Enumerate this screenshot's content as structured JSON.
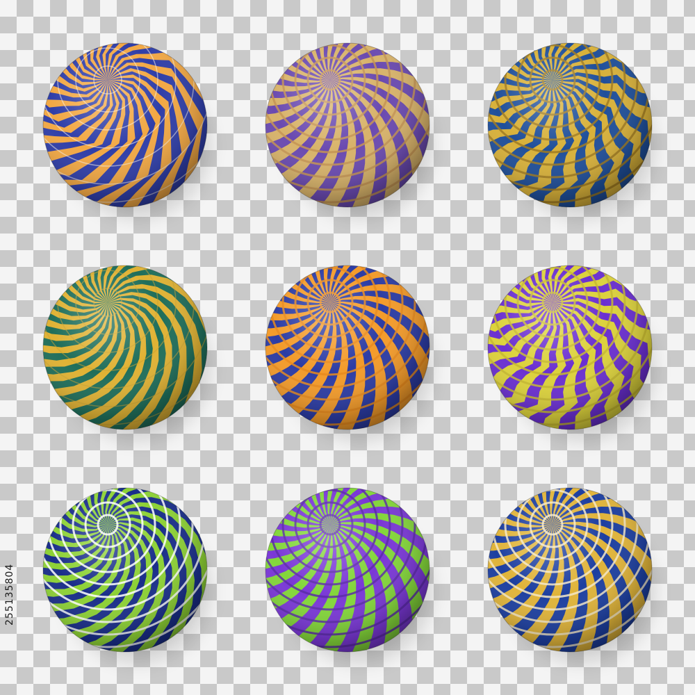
{
  "scene": {
    "background": {
      "light": "#f4f4f4",
      "dark": "#c9c9c9"
    },
    "stock_id": "255135804"
  },
  "spheres": [
    {
      "name": "sphere-zigzag-blue-orange",
      "pattern": "wavy-stripes",
      "colors": [
        "#2f3ea8",
        "#f2a844",
        "#f6efe6"
      ]
    },
    {
      "name": "sphere-triangles-purple-tan",
      "pattern": "triangles",
      "colors": [
        "#6a4ab0",
        "#d8b36a",
        "#c49352"
      ]
    },
    {
      "name": "sphere-chevrons-blue-gold",
      "pattern": "chevrons",
      "colors": [
        "#1f4f9a",
        "#d8b13a",
        "#a07a20"
      ]
    },
    {
      "name": "sphere-hexagons-green-gold",
      "pattern": "spiral-stripes",
      "colors": [
        "#1f6e5a",
        "#e0b234",
        "#c9a232"
      ]
    },
    {
      "name": "sphere-checks-orange-blue",
      "pattern": "checks",
      "colors": [
        "#f39b2a",
        "#2c3ca4",
        "#e88a1c"
      ]
    },
    {
      "name": "sphere-arrows-purple-yellow",
      "pattern": "arrows",
      "colors": [
        "#6a2fd1",
        "#dcd23c",
        "#c5b92e"
      ]
    },
    {
      "name": "sphere-triangles-green-navy",
      "pattern": "triangles-spiral",
      "colors": [
        "#8dd135",
        "#1a2e8a",
        "#ffffff"
      ]
    },
    {
      "name": "sphere-bricks-purple-green",
      "pattern": "bricks",
      "colors": [
        "#7a38d6",
        "#83d63a",
        "#5a2aa8"
      ]
    },
    {
      "name": "sphere-bricks-blue-gold",
      "pattern": "bricks-lines",
      "colors": [
        "#1d3fa0",
        "#e0b43a",
        "#f3e7c8"
      ]
    }
  ]
}
